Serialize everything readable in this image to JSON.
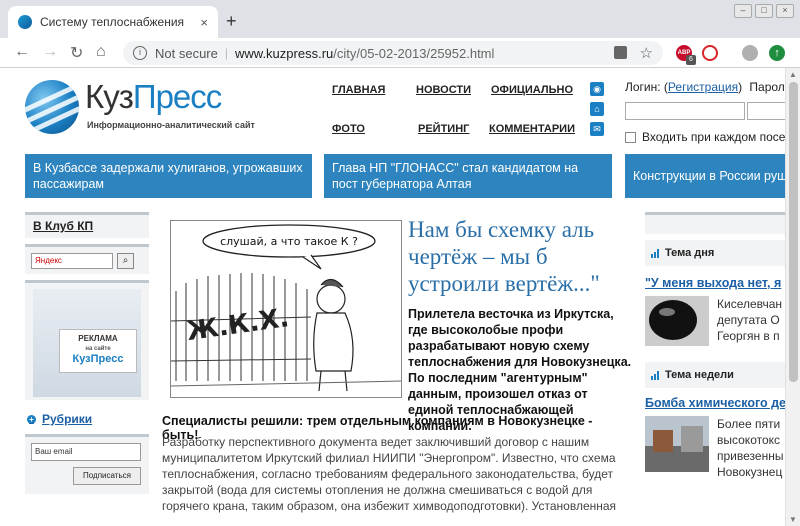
{
  "browser": {
    "tab_title": "Систему теплоснабжения",
    "tab_close": "×",
    "new_tab": "+",
    "not_secure": "Not secure",
    "url_host": "www.kuzpress.ru",
    "url_path": "/city/05-02-2013/25952.html",
    "ext_badge": "6",
    "abp_label": "ABP"
  },
  "site": {
    "logo_name_part1": "Куз",
    "logo_name_part2": "Пресс",
    "logo_subtitle": "Информационно-аналитический сайт",
    "menu": {
      "home": "ГЛАВНАЯ",
      "news": "НОВОСТИ",
      "official": "ОФИЦИАЛЬНО",
      "photo": "ФОТО",
      "rating": "РЕЙТИНГ",
      "comments": "КОММЕНТАРИИ"
    },
    "login": {
      "label": "Логин: (",
      "register": "Регистрация",
      "close_paren": ")",
      "password": "Пароль",
      "remember": "Входить при каждом посещении"
    }
  },
  "tickers": [
    "В Кузбассе задержали хулиганов, угрожавших пассажирам",
    "Глава НП \"ГЛОНАСС\" стал кандидатом на пост губернатора Алтая",
    "Конструкции в России рушатся"
  ],
  "left": {
    "klub": "В Клуб КП",
    "search_placeholder": "Яндекс",
    "search_icon": "magnifier-icon",
    "promo_line1": "РЕКЛАМА",
    "promo_line2": "на сайте",
    "promo_brand": "КузПресс",
    "rubriki": "Рубрики",
    "email_placeholder": "Ваш email",
    "subscribe": "Подписаться"
  },
  "article": {
    "cartoon_speech": "слушай, а что такое К ?",
    "cartoon_fence": "Ж.К.Х.",
    "headline": "Нам бы схемку аль чертёж – мы б устроили вертёж...\"",
    "lead": "Прилетела весточка из Иркутска, где высоколобые профи разрабатывают новую схему теплоснабжения для Новокузнецка. По последним \"агентурным\" данным, произошел отказ от единой теплоснабжающей компании.",
    "lead2": "Специалисты решили: трем отдельным компаниям в Новокузнецке - быть!",
    "body": "Разработку перспективного документа ведет заключивший договор с нашим муниципалитетом Иркутский филиал НИИПИ \"Энергопром\". Известно, что схема теплоснабжения, согласно требованиям федерального законодательства, будет закрытой (вода для системы отопления не должна смешиваться с водой для горячего крана, таким образом, она избежит химводоподготовки). Установленная"
  },
  "right": {
    "theme_day": "Тема дня",
    "day_link": "\"У меня выхода нет, я",
    "day_text": [
      "Киселевчан",
      "депутата О",
      "Георгян в п"
    ],
    "theme_week": "Тема недели",
    "week_link": "Бомба химического де",
    "week_text": [
      "Более пяти",
      "высокотокс",
      "привезенны",
      "Новокузнец"
    ]
  },
  "colors": {
    "accent": "#1b7fc4",
    "ticker_bg": "#2d84be",
    "link": "#1b5fa5",
    "headline": "#2a6fa8"
  }
}
